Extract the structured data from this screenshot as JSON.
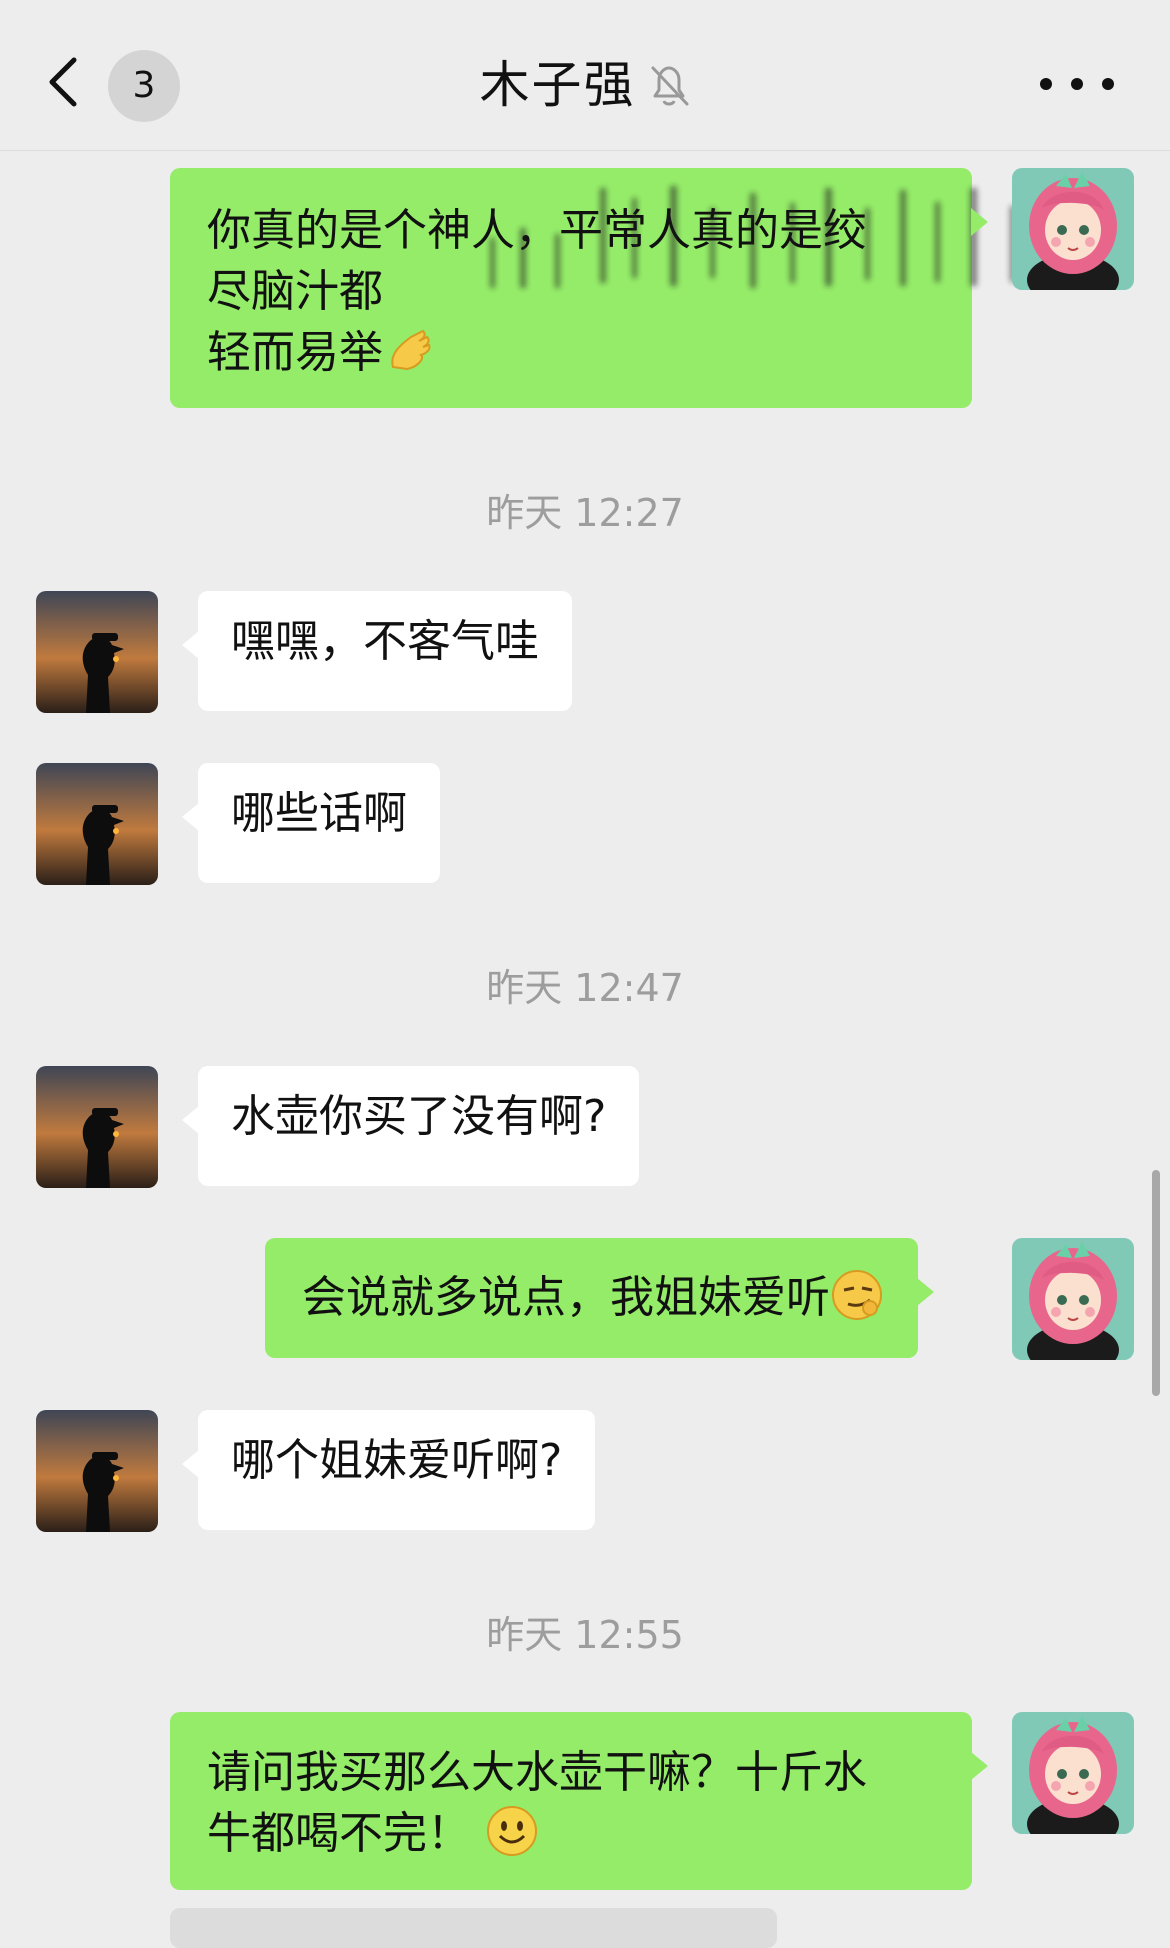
{
  "header": {
    "back_icon": "chevron-left-icon",
    "unread_count": "3",
    "title": "木子强",
    "mute_icon": "bell-off-icon",
    "more_icon": "more-dots-icon"
  },
  "messages": [
    {
      "side": "me",
      "lines": [
        "你真的是个神人，平常人真的是绞",
        "尽脑汁都",
        "轻而易举"
      ],
      "emoji": "clapping-hands-emoji"
    },
    {
      "timestamp": "昨天 12:27"
    },
    {
      "side": "them",
      "text": "嘿嘿，不客气哇"
    },
    {
      "side": "them",
      "text": "哪些话啊"
    },
    {
      "timestamp": "昨天 12:47"
    },
    {
      "side": "them",
      "text": "水壶你买了没有啊?"
    },
    {
      "side": "me",
      "text": "会说就多说点，我姐妹爱听",
      "emoji": "smirking-face-emoji"
    },
    {
      "side": "them",
      "text": "哪个姐妹爱听啊?"
    },
    {
      "timestamp": "昨天 12:55"
    },
    {
      "side": "me",
      "lines": [
        "请问我买那么大水壶干嘛？十斤水",
        "牛都喝不完！"
      ],
      "emoji": "smiling-face-emoji"
    }
  ],
  "colors": {
    "background": "#ededed",
    "my_bubble": "#95ec69",
    "their_bubble": "#ffffff",
    "timestamp_text": "#9d9d9d"
  }
}
